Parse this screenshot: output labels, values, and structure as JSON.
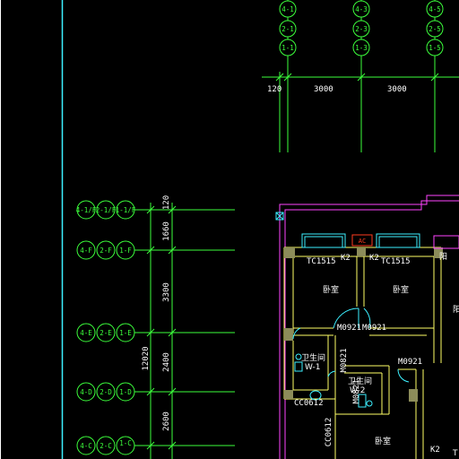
{
  "top_axes": {
    "columns": [
      {
        "bubbles": [
          "4-1",
          "2-1",
          "1-1"
        ]
      },
      {
        "bubbles": [
          "4-3",
          "2-3",
          "1-3"
        ]
      },
      {
        "bubbles": [
          "4-5",
          "2-5",
          "1-5"
        ]
      }
    ],
    "dims": [
      "120",
      "3000",
      "3000"
    ]
  },
  "left_axes": {
    "rows": [
      {
        "bubbles": [
          "4-1/F",
          "2-1/F",
          "1-1/F"
        ]
      },
      {
        "bubbles": [
          "4-F",
          "2-F",
          "1-F"
        ]
      },
      {
        "bubbles": [
          "4-E",
          "2-E",
          "1-E"
        ]
      },
      {
        "bubbles": [
          "4-D",
          "2-D",
          "1-D"
        ]
      },
      {
        "bubbles": [
          "4-C",
          "2-C",
          "1-C"
        ]
      }
    ],
    "dims": [
      "120",
      "1660",
      "3300",
      "2400",
      "2600"
    ],
    "total": "12020"
  },
  "rooms": [
    {
      "label": "卧室"
    },
    {
      "label": "卧室"
    },
    {
      "label": "卫生间"
    },
    {
      "label": "W-1"
    },
    {
      "label": "卫生间"
    },
    {
      "label": "W-2"
    },
    {
      "label": "卧室"
    }
  ],
  "openings": {
    "windows": [
      "TC1515",
      "K2",
      "K2",
      "TC1515",
      "K2"
    ],
    "doors": [
      "M0921",
      "M0921",
      "M0821",
      "M0821",
      "M0921"
    ],
    "small": [
      "CC0612",
      "CC0612"
    ],
    "partial": [
      "阳",
      "阳",
      "T"
    ],
    "ac_tag": "AC"
  },
  "colors": {
    "background": "#000000",
    "axis": "#3cff3c",
    "wall": "#ffff66",
    "window": "#3cf0ff",
    "boundary": "#ff44ff",
    "hatch": "#8c8c5a",
    "accent": "#ff3b1f"
  }
}
